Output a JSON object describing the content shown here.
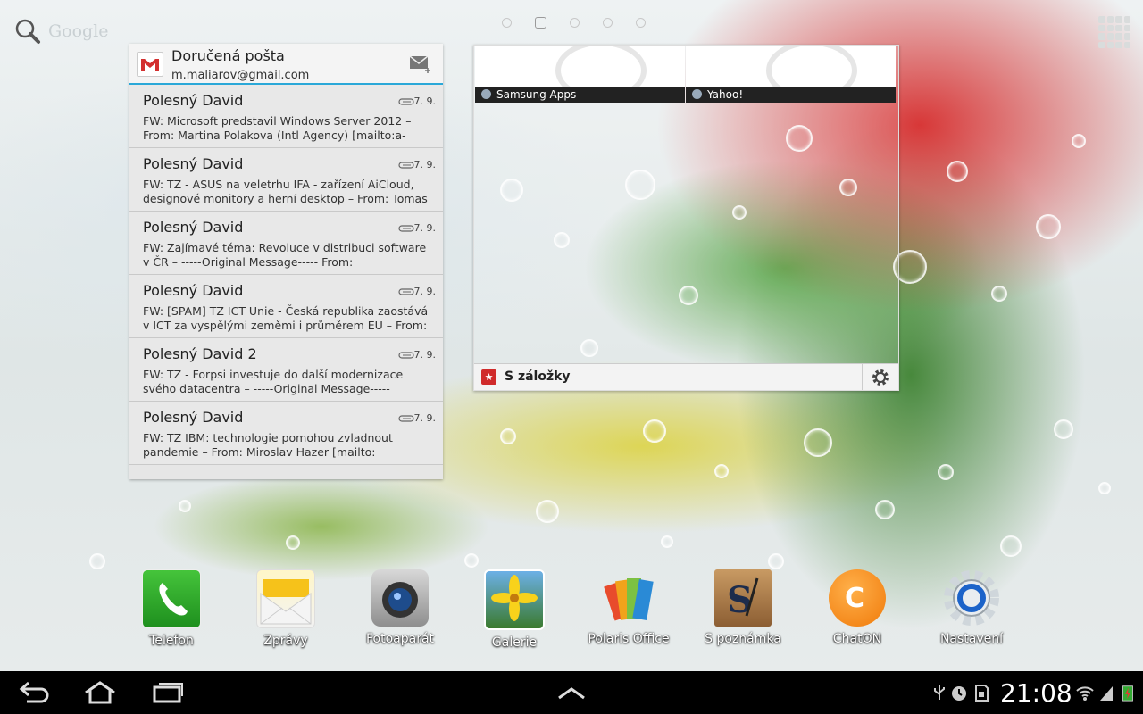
{
  "search": {
    "label": "Google"
  },
  "pager": {
    "count": 5,
    "active": 1
  },
  "mail": {
    "title": "Doručená pošta",
    "account": "m.maliarov@gmail.com",
    "messages": [
      {
        "from": "Polesný David",
        "date": "7. 9.",
        "snippet": "FW: Microsoft predstavil Windows Server 2012 – From: Martina Polakova (Intl Agency) [mailto:a-"
      },
      {
        "from": "Polesný David",
        "date": "7. 9.",
        "snippet": "FW: TZ - ASUS na veletrhu IFA - zařízení AiCloud, designové monitory a herní desktop – From: Tomas"
      },
      {
        "from": "Polesný David",
        "date": "7. 9.",
        "snippet": "FW: Zajímavé téma: Revoluce v distribuci software v ČR – -----Original Message----- From:"
      },
      {
        "from": "Polesný David",
        "date": "7. 9.",
        "snippet": "FW: [SPAM]  TZ ICT Unie - Česká republika zaostává v ICT za vyspělými zeměmi i průměrem EU – From:"
      },
      {
        "from": "Polesný David  2",
        "date": "7. 9.",
        "snippet": "FW: TZ - Forpsi investuje do další modernizace svého datacentra – -----Original Message-----"
      },
      {
        "from": "Polesný David",
        "date": "7. 9.",
        "snippet": "FW: TZ IBM: technologie pomohou zvladnout pandemie – From: Miroslav Hazer [mailto:"
      }
    ]
  },
  "bookmarks": {
    "items": [
      {
        "label": "Samsung Apps"
      },
      {
        "label": "Yahoo!"
      }
    ],
    "footer_label": "S záložky"
  },
  "dock": [
    {
      "label": "Telefon",
      "icon": "phone-icon"
    },
    {
      "label": "Zprávy",
      "icon": "messages-icon"
    },
    {
      "label": "Fotoaparát",
      "icon": "camera-icon"
    },
    {
      "label": "Galerie",
      "icon": "gallery-icon"
    },
    {
      "label": "Polaris Office",
      "icon": "polaris-office-icon"
    },
    {
      "label": "S poznámka",
      "icon": "s-note-icon"
    },
    {
      "label": "ChatON",
      "icon": "chaton-icon"
    },
    {
      "label": "Nastavení",
      "icon": "settings-icon"
    }
  ],
  "status": {
    "time": "21:08"
  },
  "colors": {
    "accent": "#2aa8d8",
    "bar": "#000000"
  }
}
